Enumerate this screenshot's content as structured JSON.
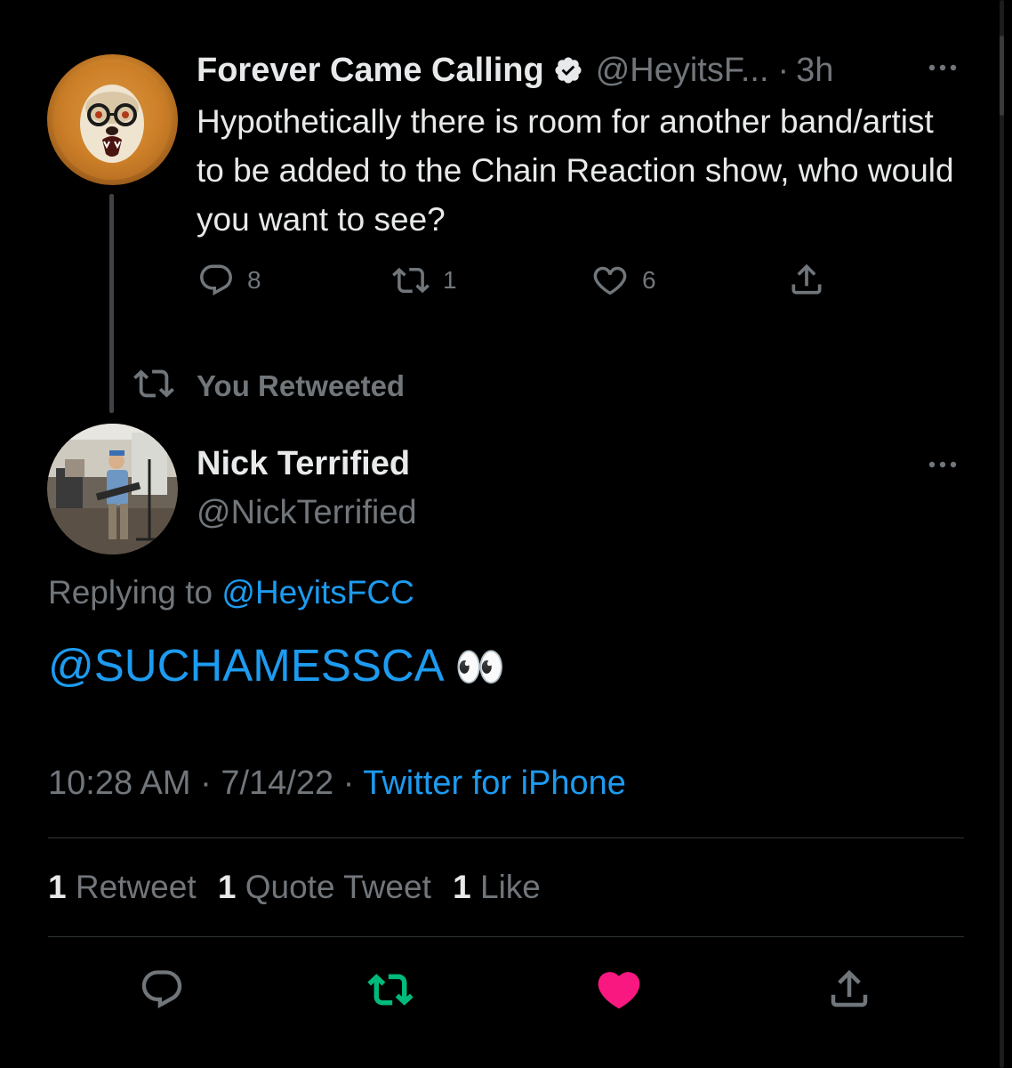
{
  "parent_tweet": {
    "author_name": "Forever Came Calling",
    "author_handle": "@HeyitsF...",
    "separator": "·",
    "time_ago": "3h",
    "text": "Hypothetically there is room for another band/artist to be added to the Chain Reaction show, who would you want to see?",
    "replies": "8",
    "retweets": "1",
    "likes": "6"
  },
  "retweet_context": {
    "label": "You Retweeted"
  },
  "main_tweet": {
    "author_name": "Nick Terrified",
    "author_handle": "@NickTerrified",
    "replying_to_label": "Replying to",
    "replying_to_handle": "@HeyitsFCC",
    "mention": "@SUCHAMESSCA",
    "emoji": "👀",
    "time": "10:28 AM",
    "date": "7/14/22",
    "source": "Twitter for iPhone",
    "separator": "·"
  },
  "stats": {
    "retweets_count": "1",
    "retweets_label": "Retweet",
    "quotes_count": "1",
    "quotes_label": "Quote Tweet",
    "likes_count": "1",
    "likes_label": "Like"
  },
  "colors": {
    "background": "#000000",
    "text": "#e7e9ea",
    "muted": "#71767b",
    "link": "#1d9bf0",
    "retweet_active": "#00ba7c",
    "like_active": "#f91880"
  },
  "icons": {
    "verified": "verified-badge-icon",
    "more": "more-icon",
    "reply": "reply-icon",
    "retweet": "retweet-icon",
    "like": "heart-icon",
    "share": "share-icon"
  }
}
